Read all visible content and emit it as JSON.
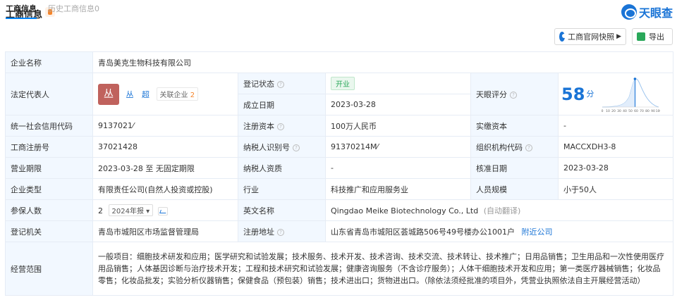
{
  "header": {
    "title": "工商信息",
    "logo_text": "天眼查"
  },
  "tabs": [
    {
      "label": "工商信息"
    },
    {
      "label": "历史工商信息0"
    }
  ],
  "actions": {
    "official_snapshot": "工商官网快照",
    "export": "导出"
  },
  "info": {
    "company_name_label": "企业名称",
    "company_name": "青岛美克生物科技有限公司",
    "legal_rep_label": "法定代表人",
    "legal_rep_avatar": "丛",
    "legal_rep_name": "丛 超",
    "assoc_label": "关联企业",
    "assoc_count": "2",
    "reg_status_label": "登记状态",
    "reg_status": "开业",
    "found_date_label": "成立日期",
    "found_date": "2023-03-28",
    "score_label": "天眼评分",
    "score": "58",
    "score_unit": "分",
    "credit_code_label": "统一社会信用代码",
    "credit_code": "9137021⁄",
    "reg_capital_label": "注册资本",
    "reg_capital": "100万人民币",
    "paid_capital_label": "实缴资本",
    "paid_capital": "-",
    "reg_no_label": "工商注册号",
    "reg_no": "37021428",
    "taxpayer_id_label": "纳税人识别号",
    "taxpayer_id": "91370214M⁄",
    "org_code_label": "组织机构代码",
    "org_code": "MACCXDH3-8",
    "term_label": "营业期限",
    "term": "2023-03-28 至 无固定期限",
    "taxpayer_qual_label": "纳税人资质",
    "taxpayer_qual": "-",
    "approve_date_label": "核准日期",
    "approve_date": "2023-03-28",
    "company_type_label": "企业类型",
    "company_type": "有限责任公司(自然人投资或控股)",
    "industry_label": "行业",
    "industry": "科技推广和应用服务业",
    "staff_size_label": "人员规模",
    "staff_size": "小于50人",
    "insured_label": "参保人数",
    "insured": "2",
    "insured_year": "2024年报",
    "english_name_label": "英文名称",
    "english_name": "Qingdao Meike Biotechnology Co., Ltd",
    "auto_translate": "(自动翻译)",
    "reg_authority_label": "登记机关",
    "reg_authority": "青岛市城阳区市场监督管理局",
    "reg_address_label": "注册地址",
    "reg_address": "山东省青岛市城阳区荟城路506号49号楼办公1001户",
    "nearby_label": "附近公司",
    "scope_label": "经营范围",
    "scope": "一般项目：细胞技术研发和应用；医学研究和试验发展；技术服务、技术开发、技术咨询、技术交流、技术转让、技术推广；日用品销售；卫生用品和一次性使用医疗用品销售；人体基因诊断与治疗技术开发；工程和技术研究和试验发展；健康咨询服务（不含诊疗服务）；人体干细胞技术开发和应用；第一类医疗器械销售；化妆品零售；化妆品批发；实验分析仪器销售；保健食品（预包装）销售；技术进出口；货物进出口。（除依法须经批准的项目外，凭营业执照依法自主开展经营活动）"
  },
  "score_chart": {
    "ticks": [
      "0",
      "10",
      "20",
      "30",
      "40",
      "50",
      "60",
      "70",
      "80",
      "90",
      "100"
    ],
    "marker_value": 58
  },
  "colors": {
    "accent": "#1a74d6",
    "label_bg": "#f2f8ff",
    "status_green": "#2aa85a",
    "avatar": "#c0625d"
  }
}
